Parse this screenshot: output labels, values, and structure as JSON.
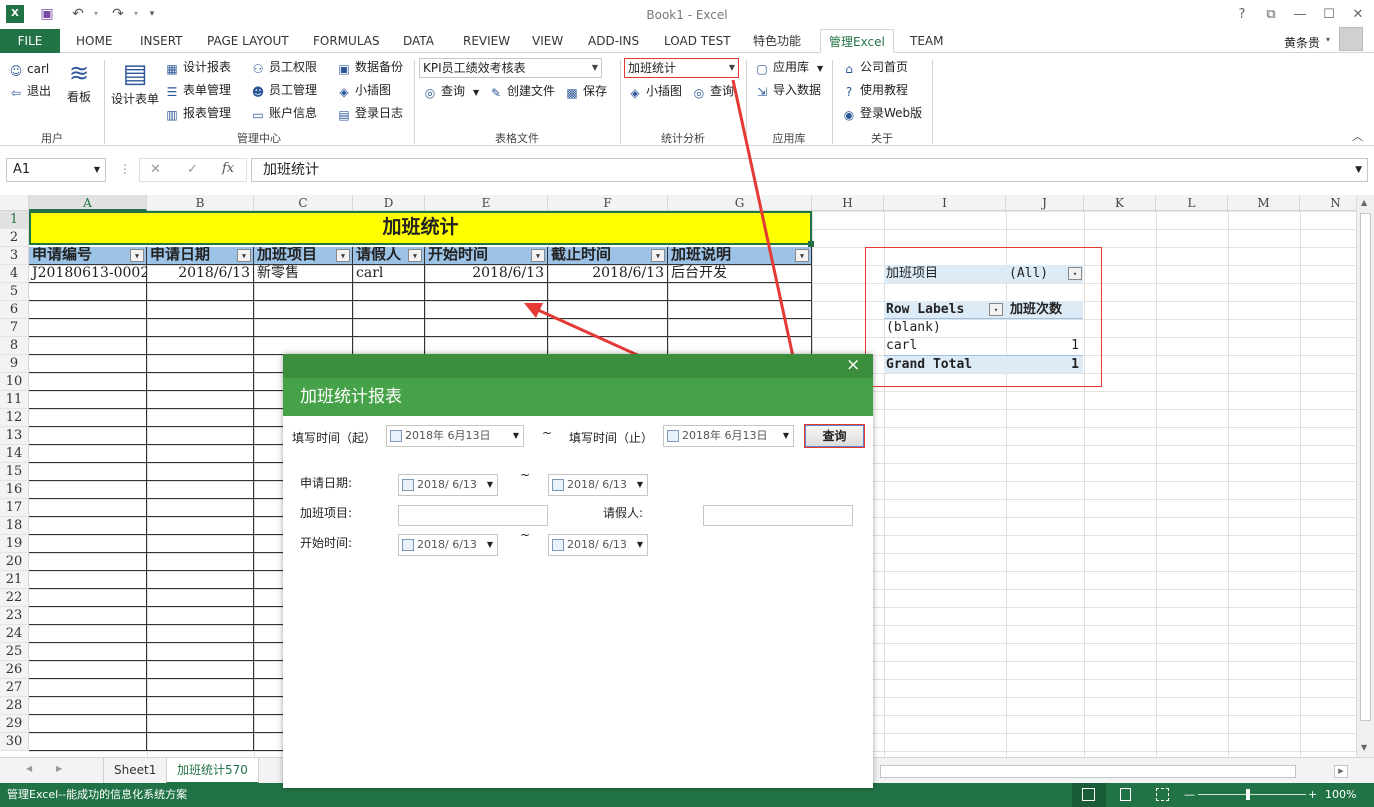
{
  "window": {
    "title": "Book1 - Excel",
    "user": "黄条贵",
    "user_caret": "▾",
    "qat_dropdown": "▾",
    "controls": {
      "help": "?",
      "restore_ribbon": "⧉",
      "minimize": "—",
      "maximize": "☐",
      "close": "✕"
    }
  },
  "tabs": [
    "HOME",
    "INSERT",
    "PAGE LAYOUT",
    "FORMULAS",
    "DATA",
    "REVIEW",
    "VIEW",
    "ADD-INS",
    "LOAD TEST",
    "特色功能",
    "管理Excel",
    "TEAM"
  ],
  "file_tab": "FILE",
  "active_tab_index": 10,
  "ribbon": {
    "user_group": {
      "user": "carl",
      "logout": "退出",
      "board": "看板",
      "label": "用户"
    },
    "mgmt_group": {
      "design_form": "设计表单",
      "col1": [
        "设计报表",
        "表单管理",
        "报表管理"
      ],
      "col2": [
        "员工权限",
        "员工管理",
        "账户信息"
      ],
      "col3": [
        "数据备份",
        "小插图",
        "登录日志"
      ],
      "label": "管理中心"
    },
    "file_group": {
      "combo": "KPI员工绩效考核表",
      "query": "查询",
      "create": "创建文件",
      "save": "保存",
      "label": "表格文件"
    },
    "stats_group": {
      "combo": "加班统计",
      "sparkline": "小插图",
      "query": "查询",
      "label": "统计分析"
    },
    "app_group": {
      "store": "应用库",
      "import": "导入数据",
      "label": "应用库"
    },
    "about_group": {
      "home": "公司首页",
      "tutorial": "使用教程",
      "web": "登录Web版",
      "label": "关于"
    }
  },
  "formula_bar": {
    "name_box": "A1",
    "cancel": "✕",
    "enter": "✓",
    "fx": "fx",
    "content": "加班统计",
    "more": "⋮"
  },
  "grid": {
    "columns": [
      "A",
      "B",
      "C",
      "D",
      "E",
      "F",
      "G",
      "H",
      "I",
      "J",
      "K",
      "L",
      "M",
      "N"
    ],
    "rows": [
      "1",
      "2",
      "3",
      "4",
      "5",
      "6",
      "7",
      "8",
      "9",
      "10",
      "11",
      "12",
      "13",
      "14",
      "15",
      "16",
      "17",
      "18",
      "19",
      "20",
      "21",
      "22",
      "23",
      "24",
      "25",
      "26",
      "27",
      "28",
      "29",
      "30"
    ],
    "title": "加班统计",
    "headers": [
      "申请编号",
      "申请日期",
      "加班项目",
      "请假人",
      "开始时间",
      "截止时间",
      "加班说明"
    ],
    "filter_glyph": "▾",
    "row4": [
      "J20180613-0002",
      "2018/6/13",
      "新零售",
      "carl",
      "2018/6/13",
      "2018/6/13",
      "后台开发"
    ]
  },
  "pivot": {
    "filter_label": "加班项目",
    "filter_value": "(All)",
    "row_labels": "Row Labels",
    "count_header": "加班次数",
    "rows": [
      {
        "label": "(blank)",
        "value": ""
      },
      {
        "label": "carl",
        "value": "1"
      }
    ],
    "total_label": "Grand Total",
    "total_value": "1"
  },
  "dialog": {
    "title": "加班统计报表",
    "close": "×",
    "from_label": "填写时间（起）",
    "from_value": "2018年  6月13日",
    "tilde": "~",
    "to_label": "填写时间（止）",
    "to_value": "2018年  6月13日",
    "query_button": "查询",
    "apply_date_label": "申请日期:",
    "apply_date_from": "2018/ 6/13",
    "apply_date_to": "2018/ 6/13",
    "project_label": "加班项目:",
    "leave_person_label": "请假人:",
    "start_time_label": "开始时间:",
    "start_time_from": "2018/ 6/13",
    "start_time_to": "2018/ 6/13"
  },
  "sheets": [
    "Sheet1",
    "加班统计570"
  ],
  "active_sheet_index": 1,
  "sheet_nav": {
    "prev": "◀",
    "next": "▶",
    "add": "⊕",
    "more": "…"
  },
  "status": {
    "text": "管理Excel--能成功的信息化系统方案",
    "zoom": "100%"
  },
  "colors": {
    "excel_green": "#217346",
    "highlight_yellow": "#ffff00",
    "header_blue": "#9cc2e5",
    "annotation_red": "#e53935",
    "dialog_green": "#46a248"
  }
}
